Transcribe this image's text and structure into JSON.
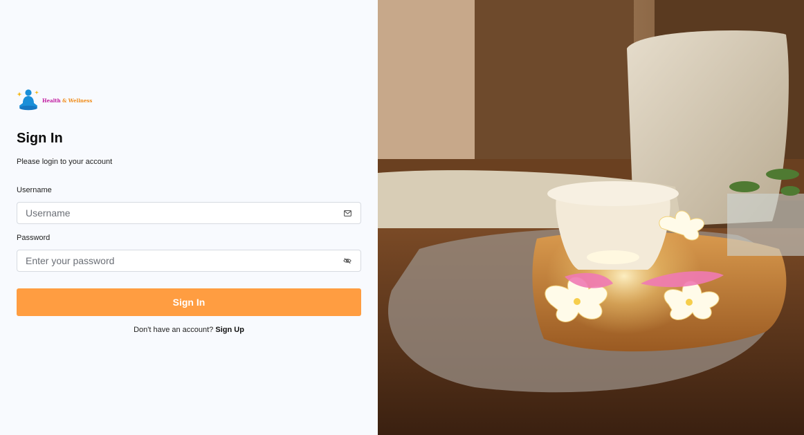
{
  "brand": {
    "logo_text_primary": "Health",
    "logo_text_secondary": "Wellness",
    "logo_primary_color": "#c0169e",
    "logo_secondary_color": "#f08a16",
    "logo_figure_color": "#1a8fd8"
  },
  "form": {
    "title": "Sign In",
    "subtitle": "Please login to your account",
    "username": {
      "label": "Username",
      "placeholder": "Username",
      "value": "",
      "icon": "mail-icon"
    },
    "password": {
      "label": "Password",
      "placeholder": "Enter your password",
      "value": "",
      "icon": "eye-off-icon"
    },
    "submit_label": "Sign In",
    "submit_color": "#ff9d41",
    "signup_prompt": "Don't have an account?",
    "signup_link": "Sign Up"
  },
  "hero": {
    "image": "spa-candle-flowers-photo"
  }
}
